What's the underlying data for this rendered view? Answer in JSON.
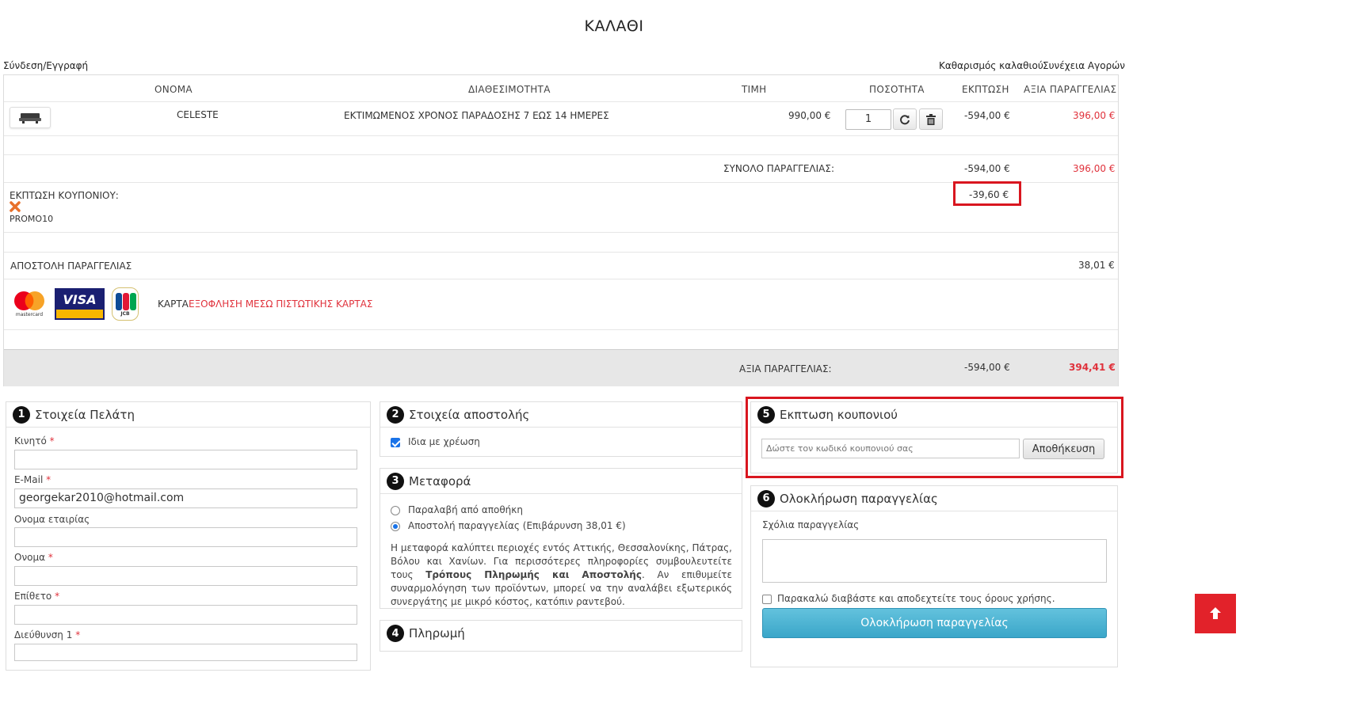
{
  "page": {
    "title": "ΚΑΛΑΘΙ"
  },
  "top_links": {
    "login": "Σύνδεση/Εγγραφή",
    "clear_cart": "Καθαρισμός καλαθιού",
    "continue_shopping": "Συνέχεια Αγορών"
  },
  "cart": {
    "headers": {
      "name": "ΟΝΟΜΑ",
      "availability": "ΔΙΑΘΕΣΙΜΟΤΗΤΑ",
      "price": "ΤΙΜΗ",
      "quantity": "ΠΟΣΟΤΗΤΑ",
      "discount": "ΕΚΠΤΩΣΗ",
      "order_value": "ΑΞΙΑ ΠΑΡΑΓΓΕΛΙΑΣ"
    },
    "item": {
      "name": "CELESTE",
      "availability": "ΕΚΤΙΜΩΜΕΝΟΣ ΧΡΟΝΟΣ ΠΑΡΑΔΟΣΗΣ 7 ΕΩΣ 14 ΗΜΕΡΕΣ",
      "price": "990,00 €",
      "quantity": "1",
      "discount": "-594,00 €",
      "value": "396,00 €"
    },
    "subtotal": {
      "label": "ΣΥΝΟΛΟ ΠΑΡΑΓΓΕΛΙΑΣ:",
      "discount": "-594,00 €",
      "value": "396,00 €"
    },
    "coupon": {
      "label": "ΕΚΠΤΩΣΗ ΚΟΥΠΟΝΙΟΥ:",
      "code": "PROMO10",
      "discount": "-39,60 €"
    },
    "shipping": {
      "label": "ΑΠΟΣΤΟΛΗ ΠΑΡΑΓΓΕΛΙΑΣ",
      "value": "38,01 €"
    },
    "payment": {
      "label": "ΚΑΡΤΑ",
      "method": "ΕΞΟΦΛΗΣΗ ΜΕΣΩ ΠΙΣΤΩΤΙΚΗΣ ΚΑΡΤΑΣ",
      "cards": {
        "mastercard": "mastercard",
        "visa": "VISA",
        "jcb": "JCB"
      }
    },
    "total": {
      "label": "ΑΞΙΑ ΠΑΡΑΓΓΕΛΙΑΣ:",
      "discount": "-594,00 €",
      "value": "394,41 €"
    }
  },
  "customer": {
    "step": "1",
    "title": "Στοιχεία Πελάτη",
    "fields": {
      "mobile": {
        "label": "Κινητό",
        "value": ""
      },
      "email": {
        "label": "E-Mail",
        "value": "georgekar2010@hotmail.com"
      },
      "company": {
        "label": "Ονομα εταιρίας",
        "value": ""
      },
      "first_name": {
        "label": "Ονομα",
        "value": ""
      },
      "last_name": {
        "label": "Επίθετο",
        "value": ""
      },
      "address1": {
        "label": "Διεύθυνση 1",
        "value": ""
      }
    },
    "required_mark": "*"
  },
  "shipping_details": {
    "step": "2",
    "title": "Στοιχεία αποστολής",
    "same_as_billing": "Ιδια με χρέωση"
  },
  "transport": {
    "step": "3",
    "title": "Μεταφορά",
    "option_pickup": "Παραλαβή από αποθήκη",
    "option_delivery": "Αποστολή παραγγελίας",
    "option_delivery_fee": "(Επιβάρυνση 38,01 €)",
    "info_1": "Η μεταφορά καλύπτει περιοχές εντός Αττικής, Θεσσαλονίκης, Πάτρας, Βόλου και Χανίων. Για περισσότερες πληροφορίες συμβουλευτείτε τους",
    "info_bold": "Τρόπους Πληρωμής και Αποστολής",
    "info_2": ". Αν επιθυμείτε συναρμολόγηση των προϊόντων, μπορεί να την αναλάβει εξωτερικός συνεργάτης με μικρό κόστος, κατόπιν ραντεβού."
  },
  "payment_panel": {
    "step": "4",
    "title": "Πληρωμή"
  },
  "coupon_panel": {
    "step": "5",
    "title": "Εκπτωση κουπονιού",
    "placeholder": "Δώστε τον κωδικό κουπονιού σας",
    "save": "Αποθήκευση"
  },
  "complete_panel": {
    "step": "6",
    "title": "Ολοκλήρωση παραγγελίας",
    "comments_label": "Σχόλια παραγγελίας",
    "terms": "Παρακαλώ διαβάστε και αποδεχτείτε τους όρους χρήσης.",
    "button": "Ολοκλήρωση παραγγελίας"
  },
  "colors": {
    "accent_red": "#e0323c",
    "highlight_red": "#d9161f",
    "button_blue": "#3aa6c9"
  }
}
